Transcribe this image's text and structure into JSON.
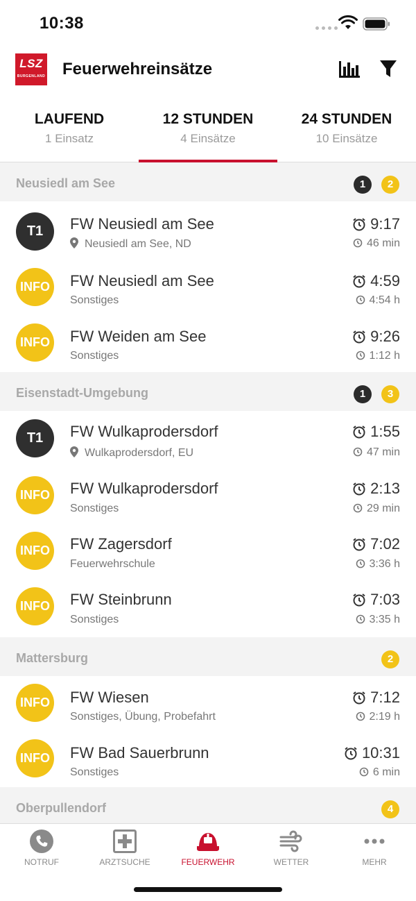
{
  "status_bar": {
    "time": "10:38"
  },
  "header": {
    "title": "Feuerwehreinsätze",
    "logo_text": "LSZ",
    "logo_subtext": "BURGENLAND"
  },
  "tabs": [
    {
      "label": "LAUFEND",
      "sub": "1 Einsatz",
      "active": false
    },
    {
      "label": "12 STUNDEN",
      "sub": "4 Einsätze",
      "active": true
    },
    {
      "label": "24 STUNDEN",
      "sub": "10 Einsätze",
      "active": false
    }
  ],
  "sections": [
    {
      "name": "Neusiedl am See",
      "badges": {
        "dark": "1",
        "yellow": "2"
      },
      "items": [
        {
          "type": "T1",
          "name": "FW Neusiedl am See",
          "sub": "Neusiedl am See, ND",
          "has_pin": true,
          "time": "9:17",
          "ago": "46 min"
        },
        {
          "type": "INFO",
          "name": "FW Neusiedl am See",
          "sub": "Sonstiges",
          "has_pin": false,
          "time": "4:59",
          "ago": "4:54 h"
        },
        {
          "type": "INFO",
          "name": "FW Weiden am See",
          "sub": "Sonstiges",
          "has_pin": false,
          "time": "9:26",
          "ago": "1:12 h"
        }
      ]
    },
    {
      "name": "Eisenstadt-Umgebung",
      "badges": {
        "dark": "1",
        "yellow": "3"
      },
      "items": [
        {
          "type": "T1",
          "name": "FW Wulkaprodersdorf",
          "sub": "Wulkaprodersdorf, EU",
          "has_pin": true,
          "time": "1:55",
          "ago": "47 min"
        },
        {
          "type": "INFO",
          "name": "FW Wulkaprodersdorf",
          "sub": "Sonstiges",
          "has_pin": false,
          "time": "2:13",
          "ago": "29 min"
        },
        {
          "type": "INFO",
          "name": "FW Zagersdorf",
          "sub": "Feuerwehrschule",
          "has_pin": false,
          "time": "7:02",
          "ago": "3:36 h"
        },
        {
          "type": "INFO",
          "name": "FW Steinbrunn",
          "sub": "Sonstiges",
          "has_pin": false,
          "time": "7:03",
          "ago": "3:35 h"
        }
      ]
    },
    {
      "name": "Mattersburg",
      "badges": {
        "yellow": "2"
      },
      "items": [
        {
          "type": "INFO",
          "name": "FW Wiesen",
          "sub": "Sonstiges, Übung, Probefahrt",
          "has_pin": false,
          "time": "7:12",
          "ago": "2:19 h"
        },
        {
          "type": "INFO",
          "name": "FW Bad Sauerbrunn",
          "sub": "Sonstiges",
          "has_pin": false,
          "time": "10:31",
          "ago": "6 min"
        }
      ]
    },
    {
      "name": "Oberpullendorf",
      "badges": {
        "yellow": "4"
      },
      "items": []
    }
  ],
  "bottom_nav": [
    {
      "label": "NOTRUF",
      "icon": "phone-icon",
      "active": false
    },
    {
      "label": "ARZTSUCHE",
      "icon": "medical-cross-icon",
      "active": false
    },
    {
      "label": "FEUERWEHR",
      "icon": "fire-helmet-icon",
      "active": true
    },
    {
      "label": "WETTER",
      "icon": "wind-icon",
      "active": false
    },
    {
      "label": "MEHR",
      "icon": "more-dots-icon",
      "active": false
    }
  ],
  "colors": {
    "accent_red": "#c8102e",
    "info_yellow": "#f2c318",
    "t1_dark": "#2f2f2f"
  }
}
